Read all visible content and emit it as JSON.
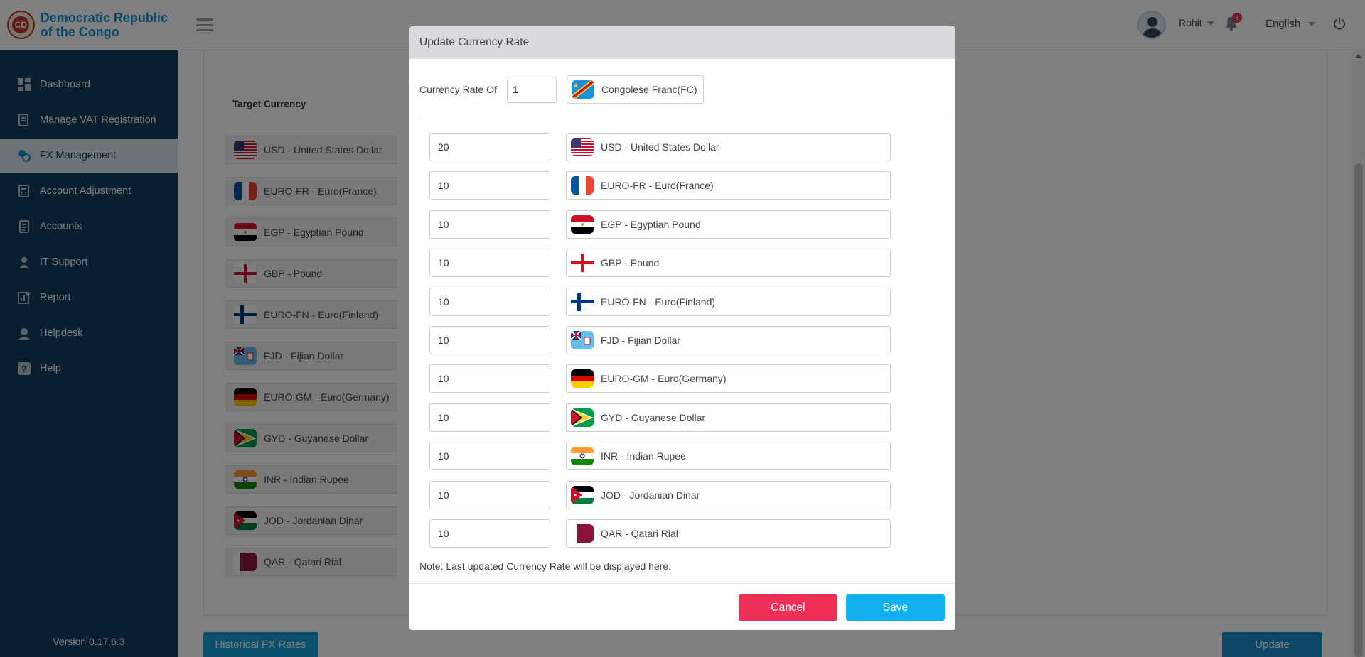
{
  "brand": {
    "name": "Democratic Republic of the Congo",
    "logo_letters": "CD"
  },
  "sidebar": {
    "items": [
      {
        "label": "Dashboard",
        "icon": "dashboard-icon"
      },
      {
        "label": "Manage VAT Registration",
        "icon": "vat-icon"
      },
      {
        "label": "FX Management",
        "icon": "fx-icon",
        "active": true
      },
      {
        "label": "Account Adjustment",
        "icon": "adjustment-icon"
      },
      {
        "label": "Accounts",
        "icon": "accounts-icon"
      },
      {
        "label": "IT Support",
        "icon": "support-icon"
      },
      {
        "label": "Report",
        "icon": "report-icon"
      },
      {
        "label": "Helpdesk",
        "icon": "helpdesk-icon"
      },
      {
        "label": "Help",
        "icon": "help-icon"
      }
    ],
    "version": "Version 0.17.6.3"
  },
  "header": {
    "user_name": "Rohit",
    "notification_count": "8",
    "language": "English"
  },
  "page": {
    "target_currency_label": "Target Currency",
    "historical_button": "Historical FX Rates",
    "update_button": "Update"
  },
  "modal": {
    "title": "Update Currency Rate",
    "rate_of_label": "Currency Rate Of",
    "rate_of_value": "1",
    "base_currency": "Congolese Franc(FC)",
    "note": "Note:  Last updated Currency Rate will be displayed here.",
    "cancel_label": "Cancel",
    "save_label": "Save"
  },
  "currencies": [
    {
      "code": "USD",
      "label": "USD - United States Dollar",
      "rate": "20",
      "flag": "us"
    },
    {
      "code": "EURO-FR",
      "label": "EURO-FR - Euro(France)",
      "rate": "10",
      "flag": "fr"
    },
    {
      "code": "EGP",
      "label": "EGP - Egyptian Pound",
      "rate": "10",
      "flag": "eg"
    },
    {
      "code": "GBP",
      "label": "GBP - Pound",
      "rate": "10",
      "flag": "gb"
    },
    {
      "code": "EURO-FN",
      "label": "EURO-FN - Euro(Finland)",
      "rate": "10",
      "flag": "fi"
    },
    {
      "code": "FJD",
      "label": "FJD - Fijian Dollar",
      "rate": "10",
      "flag": "fj"
    },
    {
      "code": "EURO-GM",
      "label": "EURO-GM - Euro(Germany)",
      "rate": "10",
      "flag": "de"
    },
    {
      "code": "GYD",
      "label": "GYD - Guyanese Dollar",
      "rate": "10",
      "flag": "gy"
    },
    {
      "code": "INR",
      "label": "INR - Indian Rupee",
      "rate": "10",
      "flag": "in"
    },
    {
      "code": "JOD",
      "label": "JOD - Jordanian Dinar",
      "rate": "10",
      "flag": "jo"
    },
    {
      "code": "QAR",
      "label": "QAR - Qatari Rial",
      "rate": "10",
      "flag": "qa"
    }
  ],
  "colors": {
    "sidebar_bg": "#0e3e5d",
    "brand_blue": "#1b8fd0",
    "cancel_red": "#ee2e57",
    "save_blue": "#10b1ee"
  }
}
